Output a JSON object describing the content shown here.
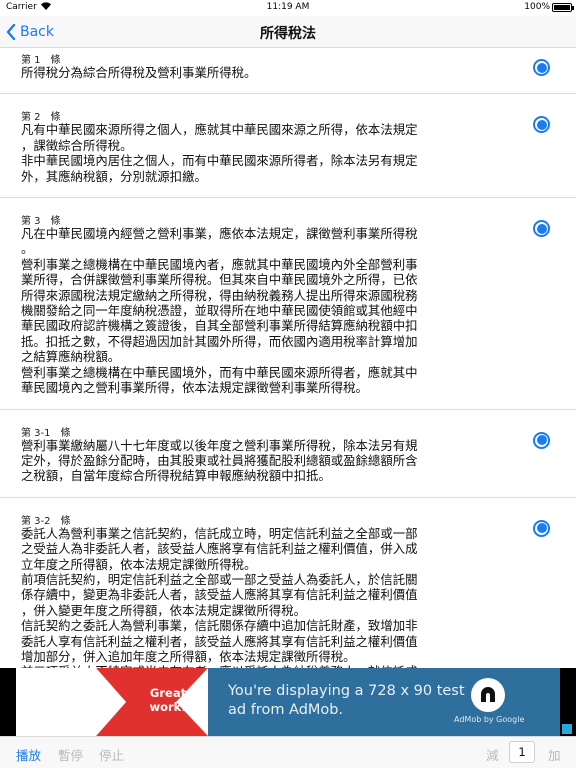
{
  "status_bar": {
    "carrier": "Carrier",
    "time": "11:19 AM",
    "battery": "100%",
    "battery_level": 1.0
  },
  "nav": {
    "back_label": "Back",
    "title": "所得稅法"
  },
  "articles": [
    {
      "number": "第 1　條",
      "selected": true,
      "text": "所得稅分為綜合所得稅及營利事業所得稅。"
    },
    {
      "number": "第 2　條",
      "selected": true,
      "text": "凡有中華民國來源所得之個人，應就其中華民國來源之所得，依本法規定\n，課徵綜合所得稅。\n非中華民國境內居住之個人，而有中華民國來源所得者，除本法另有規定\n外，其應納稅額，分別就源扣繳。"
    },
    {
      "number": "第 3　條",
      "selected": true,
      "text": "凡在中華民國境內經營之營利事業，應依本法規定，課徵營利事業所得稅\n。\n營利事業之總機構在中華民國境內者，應就其中華民國境內外全部營利事\n業所得，合併課徵營利事業所得稅。但其來自中華民國境外之所得，已依\n所得來源國稅法規定繳納之所得稅，得由納稅義務人提出所得來源國稅務\n機關發給之同一年度納稅憑證，並取得所在地中華民國使領館或其他經中\n華民國政府認許機構之簽證後，自其全部營利事業所得結算應納稅額中扣\n抵。扣抵之數，不得超過因加計其國外所得，而依國內適用稅率計算增加\n之結算應納稅額。\n營利事業之總機構在中華民國境外，而有中華民國來源所得者，應就其中\n華民國境內之營利事業所得，依本法規定課徵營利事業所得稅。"
    },
    {
      "number": "第 3-1　條",
      "selected": true,
      "text": "營利事業繳納屬八十七年度或以後年度之營利事業所得稅，除本法另有規\n定外，得於盈餘分配時，由其股東或社員將獲配股利總額或盈餘總額所含\n之稅額，自當年度綜合所得稅結算申報應納稅額中扣抵。"
    },
    {
      "number": "第 3-2　條",
      "selected": true,
      "text": "委託人為營利事業之信託契約，信託成立時，明定信託利益之全部或一部\n之受益人為非委託人者，該受益人應將享有信託利益之權利價值，併入成\n立年度之所得額，依本法規定課徵所得稅。\n前項信託契約，明定信託利益之全部或一部之受益人為委託人，於信託關\n係存續中，變更為非委託人者，該受益人應將其享有信託利益之權利價值\n，併入變更年度之所得額，依本法規定課徵所得稅。\n信託契約之委託人為營利事業，信託關係存續中追加信託財產，致增加非\n委託人享有信託利益之權利者，該受益人應將其享有信託利益之權利價值\n增加部分，併入追加年度之所得額，依本法規定課徵所得稅。\n前三項受益人不特定或尚未存在者，應以受託人為納稅義務人，就信託成"
    }
  ],
  "ad": {
    "badge_text": "Great work!",
    "headline": "You're displaying a 728 x 90 test ad from AdMob.",
    "logo_label": "AdMob by Google",
    "colors": {
      "background": "#2f6f9e",
      "badge_red": "#e0312f",
      "accent": "#1a7cf2"
    }
  },
  "toolbar": {
    "play": "播放",
    "pause": "暫停",
    "stop": "停止",
    "decrease": "減",
    "speed": "1",
    "increase": "加"
  }
}
